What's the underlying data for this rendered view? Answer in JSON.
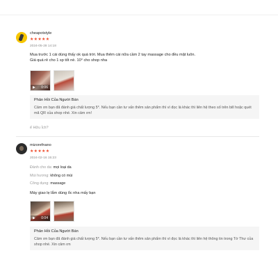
{
  "reviews": [
    {
      "username": "cheapotstyle",
      "stars": "★★★★★",
      "date": "2024-05-28 14:18",
      "text": "Mua trước 1 cái dùng thấy ok quá trời. Mua thêm cái nữa cầm 2 tay massage cho đều mặt luôn.\nGiá quá rẻ cho 1 sp tốt nè. 10° cho shop nha",
      "media": [
        {
          "type": "video",
          "duration": "0:06",
          "icon": "video-camera-icon"
        },
        {
          "type": "image"
        }
      ],
      "seller_reply": {
        "title": "Phản Hồi Của Người Bán",
        "text": "Cảm ơn bạn đã đánh giá chất lượng 5*. Nếu bạn cần tư vấn thêm sản phẩm thì vì đọc là khác thì liên hệ theo số trên bill hoặc quét mã QR của shop nhé. Xin cảm ơn!"
      },
      "helpful_label": "ể Hữu Ích?"
    },
    {
      "username": "mizorefnano",
      "stars": "★★★★★",
      "date": "2024-02-16 15:23",
      "attributes": [
        {
          "key": "Đánh cho da:",
          "value": "mọi loại da"
        },
        {
          "key": "Mùi hương:",
          "value": "không có mùi"
        },
        {
          "key": "Công dụng:",
          "value": "massage"
        }
      ],
      "text": "Máy giao lẹ lắm dùng ổc nha mấy bạn",
      "media": [
        {
          "type": "video",
          "duration": "0:04",
          "icon": "video-camera-icon"
        },
        {
          "type": "image"
        }
      ],
      "seller_reply": {
        "title": "Phản Hồi Của Người Bán",
        "text": "Cảm ơn bạn đã đánh giá chất lượng 5*. Nếu bạn cần tư vấn thêm sản phẩm thì vì đọc là khác thì liên hệ thông tin trong Tờ Thư của shop nhé. Xin cảm ơn"
      }
    }
  ],
  "colors": {
    "stars": "#ee4d2d",
    "reply_bg": "#f5f5f5"
  }
}
